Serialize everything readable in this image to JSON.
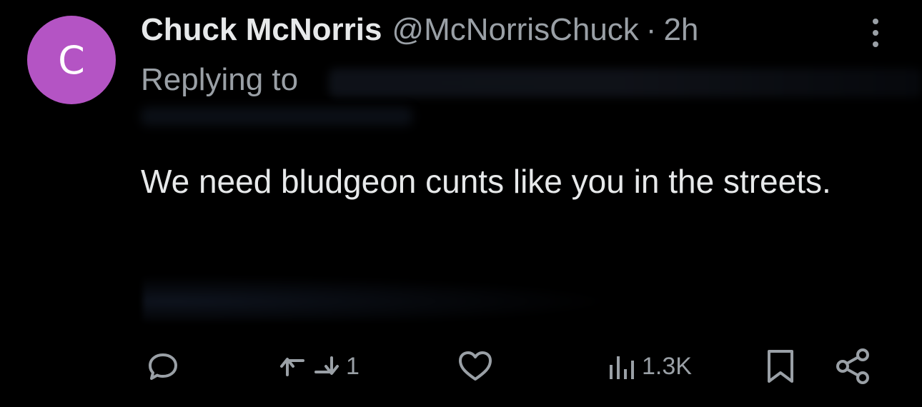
{
  "colors": {
    "background": "#000000",
    "text": "#e7e9ea",
    "muted": "#9aa0a6",
    "avatar": "#b454c4"
  },
  "tweet": {
    "avatar_letter": "C",
    "display_name": "Chuck McNorris",
    "handle": "@McNorrisChuck",
    "separator": "·",
    "time": "2h",
    "replying_to_label": "Replying to",
    "text": "We need bludgeon cunts like you in the streets."
  },
  "actions": {
    "reply": {
      "icon": "reply-icon"
    },
    "retweet": {
      "icon": "retweet-icon",
      "count": "1"
    },
    "like": {
      "icon": "heart-icon"
    },
    "views": {
      "icon": "views-icon",
      "count": "1.3K"
    },
    "bookmark": {
      "icon": "bookmark-icon"
    },
    "share": {
      "icon": "share-icon"
    }
  }
}
